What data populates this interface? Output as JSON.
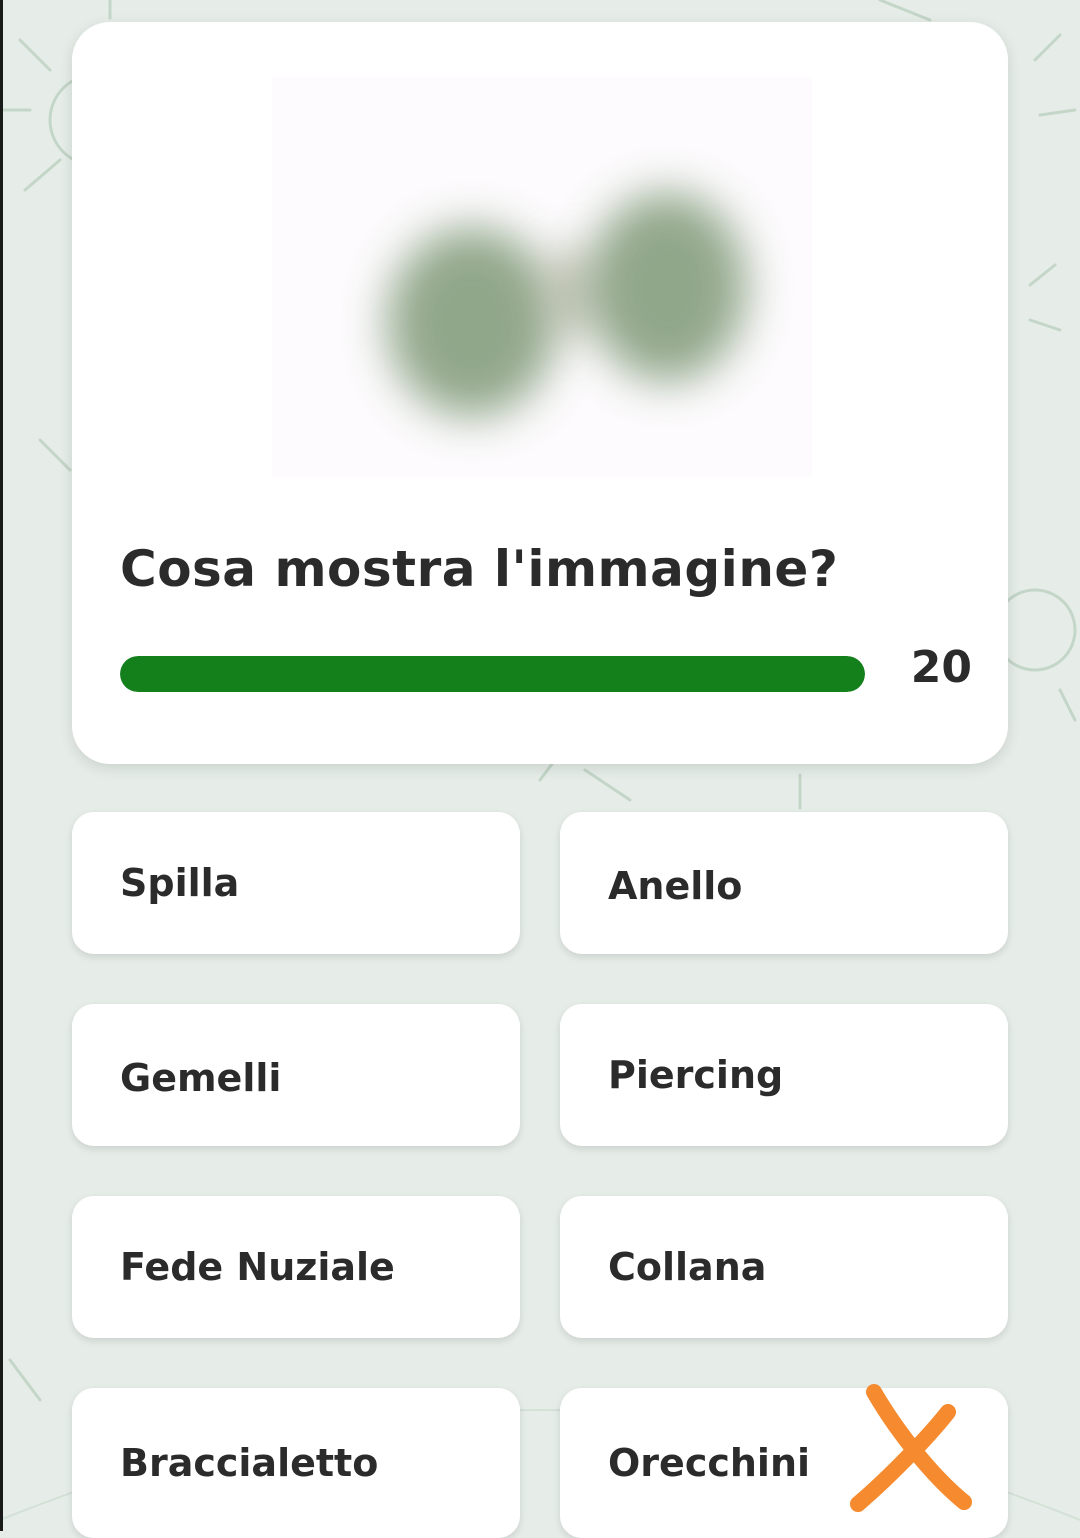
{
  "question": {
    "text": "Cosa mostra l'immagine?",
    "image_icon": "blurred-jewelry-image"
  },
  "timer": {
    "value": "20",
    "progress": 1.0,
    "color": "#14801c"
  },
  "answers": [
    {
      "label": "Spilla"
    },
    {
      "label": "Anello"
    },
    {
      "label": "Gemelli"
    },
    {
      "label": "Piercing"
    },
    {
      "label": "Fede Nuziale"
    },
    {
      "label": "Collana"
    },
    {
      "label": "Braccialetto"
    },
    {
      "label": "Orecchini"
    }
  ],
  "annotation": {
    "icon": "x-mark-icon",
    "color": "#f58a2e"
  },
  "colors": {
    "background": "#e6ede8",
    "card": "#ffffff",
    "text": "#2b2b2b"
  }
}
